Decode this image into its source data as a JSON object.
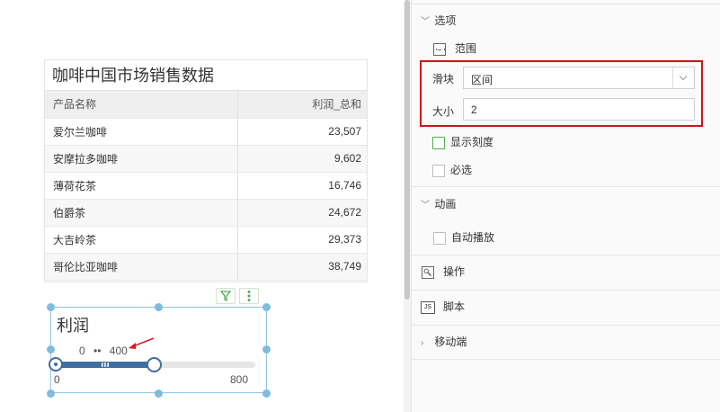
{
  "table": {
    "title": "咖啡中国市场销售数据",
    "columns": [
      "产品名称",
      "利润_总和"
    ],
    "rows": [
      [
        "爱尔兰咖啡",
        "23,507"
      ],
      [
        "安摩拉多咖啡",
        "9,602"
      ],
      [
        "薄荷花茶",
        "16,746"
      ],
      [
        "伯爵茶",
        "24,672"
      ],
      [
        "大吉岭茶",
        "29,373"
      ],
      [
        "哥伦比亚咖啡",
        "38,749"
      ]
    ]
  },
  "slider_widget": {
    "title": "利润",
    "range_low": "0",
    "range_sep": "••",
    "range_high": "400",
    "min_label": "0",
    "max_label": "800",
    "selected_fraction": 0.5,
    "track_color": "#3e6fa0",
    "tool_icons": [
      "filter-icon",
      "more-vertical-icon"
    ]
  },
  "panel": {
    "options_section": "选项",
    "range_label": "范围",
    "slider_label": "滑块",
    "slider_value": "区间",
    "size_label": "大小",
    "size_value": "2",
    "show_scale": "显示刻度",
    "required": "必选",
    "animation_section": "动画",
    "auto_play": "自动播放",
    "operation_section": "操作",
    "script_section": "脚本",
    "script_icon_text": "JS",
    "mobile_section": "移动端"
  },
  "colors": {
    "highlight": "#d0121b",
    "selection": "#7fbbdc",
    "checkbox_accent": "#4caf50"
  }
}
